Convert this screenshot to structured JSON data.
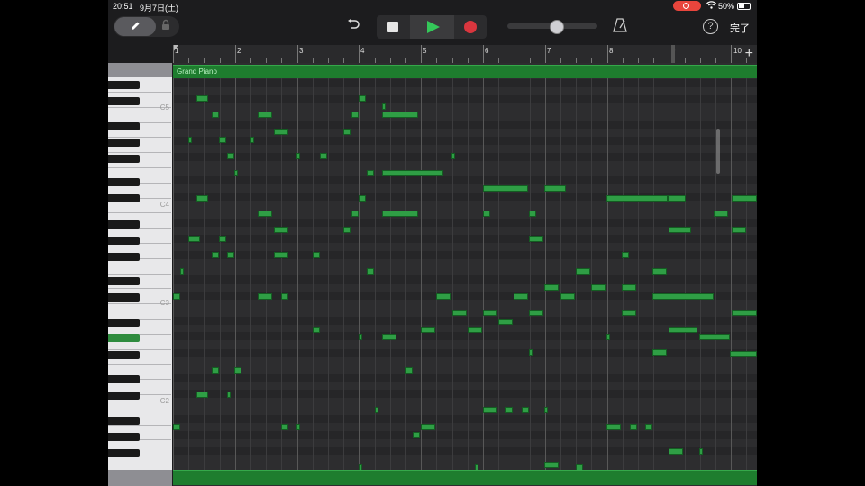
{
  "status_bar": {
    "time": "20:51",
    "date": "9月7日(土)",
    "battery": "50%"
  },
  "toolbar": {
    "pencil_icon": "pencil-icon",
    "lock_icon": "lock-icon",
    "undo_icon": "undo-icon",
    "stop_icon": "stop-icon",
    "play_icon": "play-icon",
    "record_icon": "record-icon",
    "metronome_icon": "metronome-icon",
    "help_label": "?",
    "done_label": "完了",
    "volume_level": 0.55
  },
  "ruler": {
    "bars": [
      "1",
      "2",
      "3",
      "4",
      "5",
      "6",
      "7",
      "8",
      "9",
      "10"
    ],
    "add_label": "+"
  },
  "region": {
    "name": "Grand Piano"
  },
  "keyboard": {
    "labels": [
      "C5",
      "C4",
      "C3",
      "C2"
    ]
  },
  "colors": {
    "note": "#2f9e45",
    "region": "#1e7d2e",
    "play": "#34c759",
    "record": "#d9363e"
  }
}
